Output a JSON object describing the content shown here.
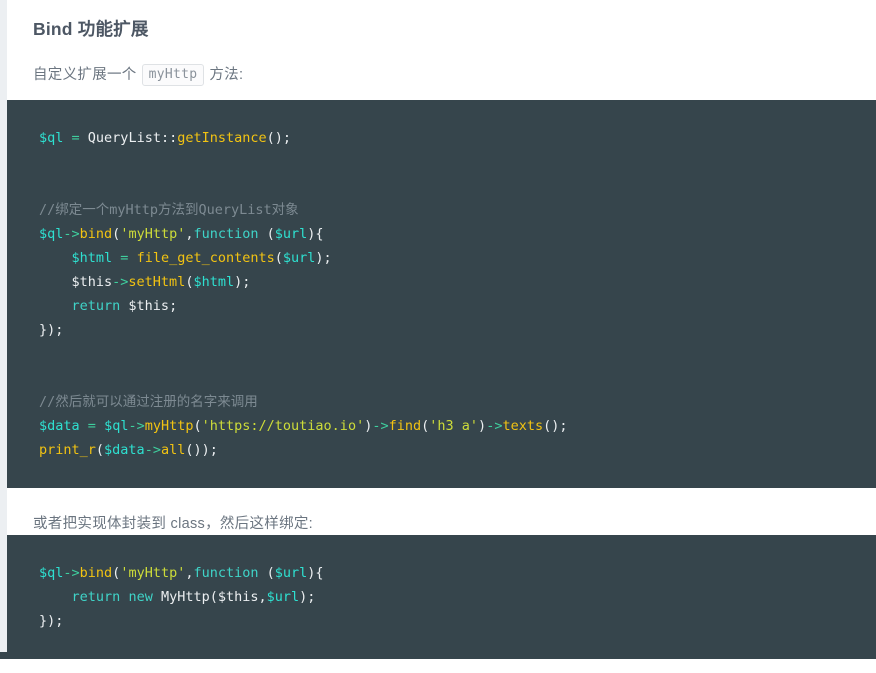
{
  "page": {
    "title": "Bind 功能扩展"
  },
  "intro": {
    "before": "自定义扩展一个",
    "inline_code": "myHttp",
    "after": "方法:"
  },
  "mid_paragraph": "或者把实现体封装到 class，然后这样绑定:",
  "code_block_1": {
    "language": "php",
    "lines": [
      {
        "tokens": [
          {
            "t": "$ql",
            "c": "t-var"
          },
          {
            "t": " ",
            "c": "t-txt"
          },
          {
            "t": "=",
            "c": "t-op"
          },
          {
            "t": " QueryList",
            "c": "t-txt"
          },
          {
            "t": "::",
            "c": "t-txt"
          },
          {
            "t": "getInstance",
            "c": "t-fn"
          },
          {
            "t": "();",
            "c": "t-pun"
          }
        ]
      },
      {
        "tokens": []
      },
      {
        "tokens": []
      },
      {
        "tokens": [
          {
            "t": "//绑定一个myHttp方法到QueryList对象",
            "c": "t-com"
          }
        ]
      },
      {
        "tokens": [
          {
            "t": "$ql",
            "c": "t-var"
          },
          {
            "t": "->",
            "c": "t-op"
          },
          {
            "t": "bind",
            "c": "t-fn"
          },
          {
            "t": "(",
            "c": "t-pun"
          },
          {
            "t": "'myHttp'",
            "c": "t-str"
          },
          {
            "t": ",",
            "c": "t-pun"
          },
          {
            "t": "function",
            "c": "t-kw"
          },
          {
            "t": " (",
            "c": "t-pun"
          },
          {
            "t": "$url",
            "c": "t-var"
          },
          {
            "t": "){",
            "c": "t-pun"
          }
        ]
      },
      {
        "tokens": [
          {
            "t": "    ",
            "c": "t-txt"
          },
          {
            "t": "$html",
            "c": "t-var"
          },
          {
            "t": " ",
            "c": "t-txt"
          },
          {
            "t": "=",
            "c": "t-op"
          },
          {
            "t": " ",
            "c": "t-txt"
          },
          {
            "t": "file_get_contents",
            "c": "t-fn"
          },
          {
            "t": "(",
            "c": "t-pun"
          },
          {
            "t": "$url",
            "c": "t-var"
          },
          {
            "t": ");",
            "c": "t-pun"
          }
        ]
      },
      {
        "tokens": [
          {
            "t": "    ",
            "c": "t-txt"
          },
          {
            "t": "$this",
            "c": "t-txt"
          },
          {
            "t": "->",
            "c": "t-op"
          },
          {
            "t": "setHtml",
            "c": "t-fn"
          },
          {
            "t": "(",
            "c": "t-pun"
          },
          {
            "t": "$html",
            "c": "t-var"
          },
          {
            "t": ");",
            "c": "t-pun"
          }
        ]
      },
      {
        "tokens": [
          {
            "t": "    ",
            "c": "t-txt"
          },
          {
            "t": "return",
            "c": "t-kw"
          },
          {
            "t": " $this;",
            "c": "t-txt"
          }
        ]
      },
      {
        "tokens": [
          {
            "t": "});",
            "c": "t-pun"
          }
        ]
      },
      {
        "tokens": []
      },
      {
        "tokens": []
      },
      {
        "tokens": [
          {
            "t": "//然后就可以通过注册的名字来调用",
            "c": "t-com"
          }
        ]
      },
      {
        "tokens": [
          {
            "t": "$data",
            "c": "t-var"
          },
          {
            "t": " ",
            "c": "t-txt"
          },
          {
            "t": "=",
            "c": "t-op"
          },
          {
            "t": " ",
            "c": "t-txt"
          },
          {
            "t": "$ql",
            "c": "t-var"
          },
          {
            "t": "->",
            "c": "t-op"
          },
          {
            "t": "myHttp",
            "c": "t-fn"
          },
          {
            "t": "(",
            "c": "t-pun"
          },
          {
            "t": "'https://toutiao.io'",
            "c": "t-str"
          },
          {
            "t": ")",
            "c": "t-pun"
          },
          {
            "t": "->",
            "c": "t-op"
          },
          {
            "t": "find",
            "c": "t-fn"
          },
          {
            "t": "(",
            "c": "t-pun"
          },
          {
            "t": "'h3 a'",
            "c": "t-str"
          },
          {
            "t": ")",
            "c": "t-pun"
          },
          {
            "t": "->",
            "c": "t-op"
          },
          {
            "t": "texts",
            "c": "t-fn"
          },
          {
            "t": "();",
            "c": "t-pun"
          }
        ]
      },
      {
        "tokens": [
          {
            "t": "print_r",
            "c": "t-fn"
          },
          {
            "t": "(",
            "c": "t-pun"
          },
          {
            "t": "$data",
            "c": "t-var"
          },
          {
            "t": "->",
            "c": "t-op"
          },
          {
            "t": "all",
            "c": "t-fn"
          },
          {
            "t": "());",
            "c": "t-pun"
          }
        ]
      }
    ]
  },
  "code_block_2": {
    "language": "php",
    "lines": [
      {
        "tokens": [
          {
            "t": "$ql",
            "c": "t-var"
          },
          {
            "t": "->",
            "c": "t-op"
          },
          {
            "t": "bind",
            "c": "t-fn"
          },
          {
            "t": "(",
            "c": "t-pun"
          },
          {
            "t": "'myHttp'",
            "c": "t-str"
          },
          {
            "t": ",",
            "c": "t-pun"
          },
          {
            "t": "function",
            "c": "t-kw"
          },
          {
            "t": " (",
            "c": "t-pun"
          },
          {
            "t": "$url",
            "c": "t-var"
          },
          {
            "t": "){",
            "c": "t-pun"
          }
        ]
      },
      {
        "tokens": [
          {
            "t": "    ",
            "c": "t-txt"
          },
          {
            "t": "return",
            "c": "t-kw"
          },
          {
            "t": " ",
            "c": "t-txt"
          },
          {
            "t": "new",
            "c": "t-kw"
          },
          {
            "t": " MyHttp(",
            "c": "t-txt"
          },
          {
            "t": "$this",
            "c": "t-txt"
          },
          {
            "t": ",",
            "c": "t-pun"
          },
          {
            "t": "$url",
            "c": "t-var"
          },
          {
            "t": ");",
            "c": "t-pun"
          }
        ]
      },
      {
        "tokens": [
          {
            "t": "});",
            "c": "t-pun"
          }
        ]
      }
    ]
  },
  "colors": {
    "code_background": "#36454c",
    "page_background": "#ffffff",
    "left_rail": "#eceff2",
    "heading": "#4d5764",
    "body_text": "#6b7580",
    "token_variable": "#2ee0d0",
    "token_operator": "#3fcf9e",
    "token_function": "#f2c312",
    "token_keyword": "#3fd4c8",
    "token_string": "#cddc39",
    "token_plain": "#eceff1",
    "token_comment": "#7d8a92"
  }
}
